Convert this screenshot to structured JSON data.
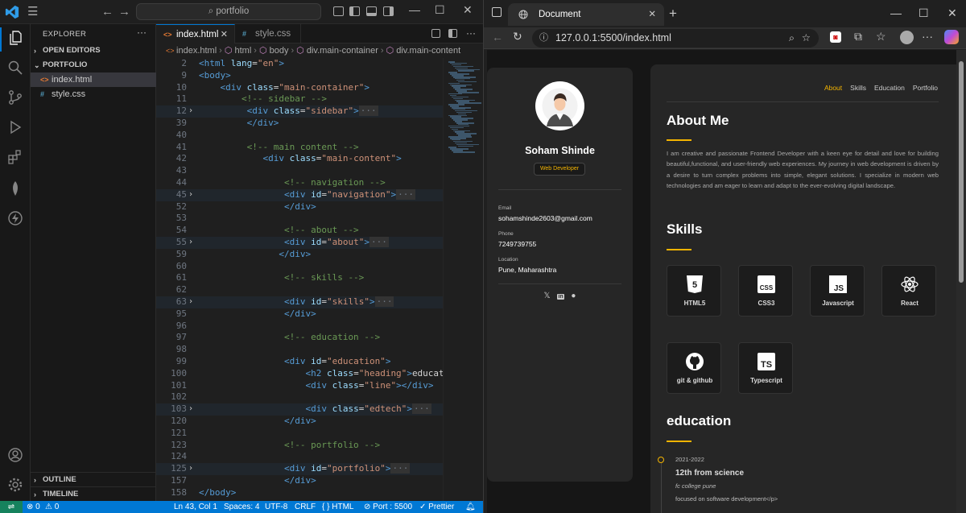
{
  "vscode": {
    "command_center": "portfolio",
    "sidebar": {
      "title": "EXPLORER",
      "more": "···",
      "open_editors": "OPEN EDITORS",
      "folder": "PORTFOLIO",
      "files": [
        "index.html",
        "style.css"
      ],
      "outline": "OUTLINE",
      "timeline": "TIMELINE"
    },
    "tabs": [
      {
        "label": "index.html",
        "close": "✕"
      },
      {
        "label": "style.css"
      }
    ],
    "breadcrumb": [
      "index.html",
      "html",
      "body",
      "div.main-container",
      "div.main-content"
    ],
    "code_lines": [
      {
        "n": "2",
        "parts": [
          [
            "tg",
            "<html "
          ],
          [
            "at",
            "lang"
          ],
          [
            "tx",
            "="
          ],
          [
            "st",
            "\"en\""
          ],
          [
            "tg",
            ">"
          ]
        ]
      },
      {
        "n": "9",
        "parts": [
          [
            "tg",
            "<body>"
          ]
        ]
      },
      {
        "n": "10",
        "parts": [
          [
            "tx",
            "    "
          ],
          [
            "tg",
            "<div "
          ],
          [
            "at",
            "class"
          ],
          [
            "tx",
            "="
          ],
          [
            "st",
            "\"main-container\""
          ],
          [
            "tg",
            ">"
          ]
        ]
      },
      {
        "n": "11",
        "parts": [
          [
            "tx",
            "        "
          ],
          [
            "cm",
            "<!-- sidebar -->"
          ]
        ]
      },
      {
        "n": "12",
        "fold": true,
        "parts": [
          [
            "tx",
            "         "
          ],
          [
            "tg",
            "<div "
          ],
          [
            "at",
            "class"
          ],
          [
            "tx",
            "="
          ],
          [
            "st",
            "\"sidebar\""
          ],
          [
            "tg",
            ">"
          ],
          [
            "el",
            "···"
          ]
        ]
      },
      {
        "n": "39",
        "parts": [
          [
            "tx",
            "         "
          ],
          [
            "tg",
            "</div>"
          ]
        ]
      },
      {
        "n": "40",
        "parts": [
          [
            "tx",
            ""
          ]
        ]
      },
      {
        "n": "41",
        "parts": [
          [
            "tx",
            "         "
          ],
          [
            "cm",
            "<!-- main content -->"
          ]
        ]
      },
      {
        "n": "42",
        "parts": [
          [
            "tx",
            "            "
          ],
          [
            "tg",
            "<div "
          ],
          [
            "at",
            "class"
          ],
          [
            "tx",
            "="
          ],
          [
            "st",
            "\"main-content\""
          ],
          [
            "tg",
            ">"
          ]
        ]
      },
      {
        "n": "43",
        "parts": [
          [
            "tx",
            ""
          ]
        ]
      },
      {
        "n": "44",
        "parts": [
          [
            "tx",
            "                "
          ],
          [
            "cm",
            "<!-- navigation -->"
          ]
        ]
      },
      {
        "n": "45",
        "fold": true,
        "parts": [
          [
            "tx",
            "                "
          ],
          [
            "tg",
            "<div "
          ],
          [
            "at",
            "id"
          ],
          [
            "tx",
            "="
          ],
          [
            "st",
            "\"navigation\""
          ],
          [
            "tg",
            ">"
          ],
          [
            "el",
            "···"
          ]
        ]
      },
      {
        "n": "52",
        "parts": [
          [
            "tx",
            "                "
          ],
          [
            "tg",
            "</div>"
          ]
        ]
      },
      {
        "n": "53",
        "parts": [
          [
            "tx",
            ""
          ]
        ]
      },
      {
        "n": "54",
        "parts": [
          [
            "tx",
            "                "
          ],
          [
            "cm",
            "<!-- about -->"
          ]
        ]
      },
      {
        "n": "55",
        "fold": true,
        "parts": [
          [
            "tx",
            "                "
          ],
          [
            "tg",
            "<div "
          ],
          [
            "at",
            "id"
          ],
          [
            "tx",
            "="
          ],
          [
            "st",
            "\"about\""
          ],
          [
            "tg",
            ">"
          ],
          [
            "el",
            "···"
          ]
        ]
      },
      {
        "n": "59",
        "parts": [
          [
            "tx",
            "               "
          ],
          [
            "tg",
            "</div>"
          ]
        ]
      },
      {
        "n": "60",
        "parts": [
          [
            "tx",
            ""
          ]
        ]
      },
      {
        "n": "61",
        "parts": [
          [
            "tx",
            "                "
          ],
          [
            "cm",
            "<!-- skills -->"
          ]
        ]
      },
      {
        "n": "62",
        "parts": [
          [
            "tx",
            ""
          ]
        ]
      },
      {
        "n": "63",
        "fold": true,
        "parts": [
          [
            "tx",
            "                "
          ],
          [
            "tg",
            "<div "
          ],
          [
            "at",
            "id"
          ],
          [
            "tx",
            "="
          ],
          [
            "st",
            "\"skills\""
          ],
          [
            "tg",
            ">"
          ],
          [
            "el",
            "···"
          ]
        ]
      },
      {
        "n": "95",
        "parts": [
          [
            "tx",
            "                "
          ],
          [
            "tg",
            "</div>"
          ]
        ]
      },
      {
        "n": "96",
        "parts": [
          [
            "tx",
            ""
          ]
        ]
      },
      {
        "n": "97",
        "parts": [
          [
            "tx",
            "                "
          ],
          [
            "cm",
            "<!-- education -->"
          ]
        ]
      },
      {
        "n": "98",
        "parts": [
          [
            "tx",
            ""
          ]
        ]
      },
      {
        "n": "99",
        "parts": [
          [
            "tx",
            "                "
          ],
          [
            "tg",
            "<div "
          ],
          [
            "at",
            "id"
          ],
          [
            "tx",
            "="
          ],
          [
            "st",
            "\"education\""
          ],
          [
            "tg",
            ">"
          ]
        ]
      },
      {
        "n": "100",
        "parts": [
          [
            "tx",
            "                    "
          ],
          [
            "tg",
            "<h2 "
          ],
          [
            "at",
            "class"
          ],
          [
            "tx",
            "="
          ],
          [
            "st",
            "\"heading\""
          ],
          [
            "tg",
            ">"
          ],
          [
            "tx",
            "education"
          ],
          [
            "tg",
            "</"
          ]
        ]
      },
      {
        "n": "101",
        "parts": [
          [
            "tx",
            "                    "
          ],
          [
            "tg",
            "<div "
          ],
          [
            "at",
            "class"
          ],
          [
            "tx",
            "="
          ],
          [
            "st",
            "\"line\""
          ],
          [
            "tg",
            "></div>"
          ]
        ]
      },
      {
        "n": "102",
        "parts": [
          [
            "tx",
            ""
          ]
        ]
      },
      {
        "n": "103",
        "fold": true,
        "parts": [
          [
            "tx",
            "                    "
          ],
          [
            "tg",
            "<div "
          ],
          [
            "at",
            "class"
          ],
          [
            "tx",
            "="
          ],
          [
            "st",
            "\"edtech\""
          ],
          [
            "tg",
            ">"
          ],
          [
            "el",
            "···"
          ]
        ]
      },
      {
        "n": "120",
        "parts": [
          [
            "tx",
            "                "
          ],
          [
            "tg",
            "</div>"
          ]
        ]
      },
      {
        "n": "121",
        "parts": [
          [
            "tx",
            ""
          ]
        ]
      },
      {
        "n": "123",
        "parts": [
          [
            "tx",
            "                "
          ],
          [
            "cm",
            "<!-- portfolio -->"
          ]
        ]
      },
      {
        "n": "124",
        "parts": [
          [
            "tx",
            ""
          ]
        ]
      },
      {
        "n": "125",
        "fold": true,
        "parts": [
          [
            "tx",
            "                "
          ],
          [
            "tg",
            "<div "
          ],
          [
            "at",
            "id"
          ],
          [
            "tx",
            "="
          ],
          [
            "st",
            "\"portfolio\""
          ],
          [
            "tg",
            ">"
          ],
          [
            "el",
            "···"
          ]
        ]
      },
      {
        "n": "157",
        "parts": [
          [
            "tx",
            "                "
          ],
          [
            "tg",
            "</div>"
          ]
        ]
      },
      {
        "n": "158",
        "parts": [
          [
            "tg",
            "</body>"
          ]
        ]
      }
    ],
    "status": {
      "errors": "⊗ 0",
      "warnings": "⚠ 0",
      "position": "Ln 43, Col 1",
      "spaces": "Spaces: 4",
      "encoding": "UTF-8",
      "eol": "CRLF",
      "language": "{ } HTML",
      "port": "Port : 5500",
      "prettier": "✓ Prettier"
    }
  },
  "browser": {
    "tab_title": "Document",
    "url": "127.0.0.1:5500/index.html"
  },
  "site": {
    "name": "Soham Shinde",
    "role": "Web Developer",
    "email_label": "Email",
    "email": "sohamshinde2603@gmail.com",
    "phone_label": "Phone",
    "phone": "7249739755",
    "location_label": "Location",
    "location": "Pune, Maharashtra",
    "nav": [
      "About",
      "Skills",
      "Education",
      "Portfolio"
    ],
    "about_heading": "About Me",
    "about_text": "I am creative and passionate Frontend Developer with a keen eye for detail and love for building beautiful,functional, and user-friendly web experiences. My journey in web development is driven by a desire to turn complex problems into simple, elegant solutions. I specialize in modern web technologies and am eager to learn and adapt to the ever-evolving digital landscape.",
    "skills_heading": "Skills",
    "skills": [
      "HTML5",
      "CSS3",
      "Javascript",
      "React",
      "git & github",
      "Typescript"
    ],
    "education_heading": "education",
    "edu_year": "2021-2022",
    "edu_title": "12th from science",
    "edu_school": "fc college pune",
    "edu_desc": "focused on software development</p>"
  },
  "colors": {
    "accent": "#f4b400",
    "vscode_blue": "#0078d4"
  }
}
